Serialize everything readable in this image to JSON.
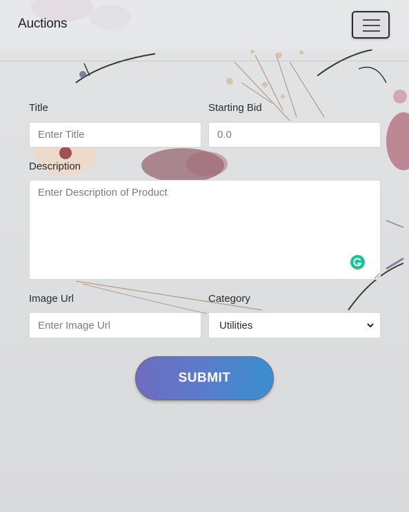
{
  "navbar": {
    "brand": "Auctions",
    "menu_icon": "hamburger-menu-icon"
  },
  "form": {
    "title": {
      "label": "Title",
      "placeholder": "Enter Title",
      "value": ""
    },
    "starting_bid": {
      "label": "Starting Bid",
      "placeholder": "0.0",
      "value": ""
    },
    "description": {
      "label": "Description",
      "placeholder": "Enter Description of Product",
      "value": ""
    },
    "image_url": {
      "label": "Image Url",
      "placeholder": "Enter Image Url",
      "value": ""
    },
    "category": {
      "label": "Category",
      "selected": "Utilities"
    },
    "submit_label": "SUBMIT",
    "grammarly_icon": "grammarly-icon"
  },
  "colors": {
    "submit_gradient_start": "#6f6cc0",
    "submit_gradient_end": "#3a8fd0",
    "grammarly": "#15c39a"
  }
}
